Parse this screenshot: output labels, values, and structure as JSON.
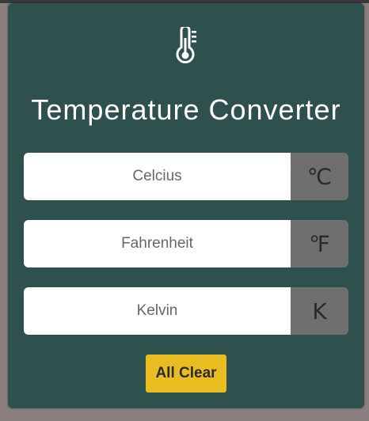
{
  "header": {
    "icon": "thermometer-icon",
    "title": "Temperature Converter"
  },
  "fields": {
    "celsius": {
      "placeholder": "Celcius",
      "value": "",
      "unit": "℃"
    },
    "fahrenheit": {
      "placeholder": "Fahrenheit",
      "value": "",
      "unit": "℉"
    },
    "kelvin": {
      "placeholder": "Kelvin",
      "value": "",
      "unit": "K"
    }
  },
  "actions": {
    "clear_label": "All Clear"
  },
  "colors": {
    "card_bg": "#2f514e",
    "unit_bg": "#6f6f6f",
    "button_bg": "#e9bd22",
    "title_text": "#ffffff"
  }
}
